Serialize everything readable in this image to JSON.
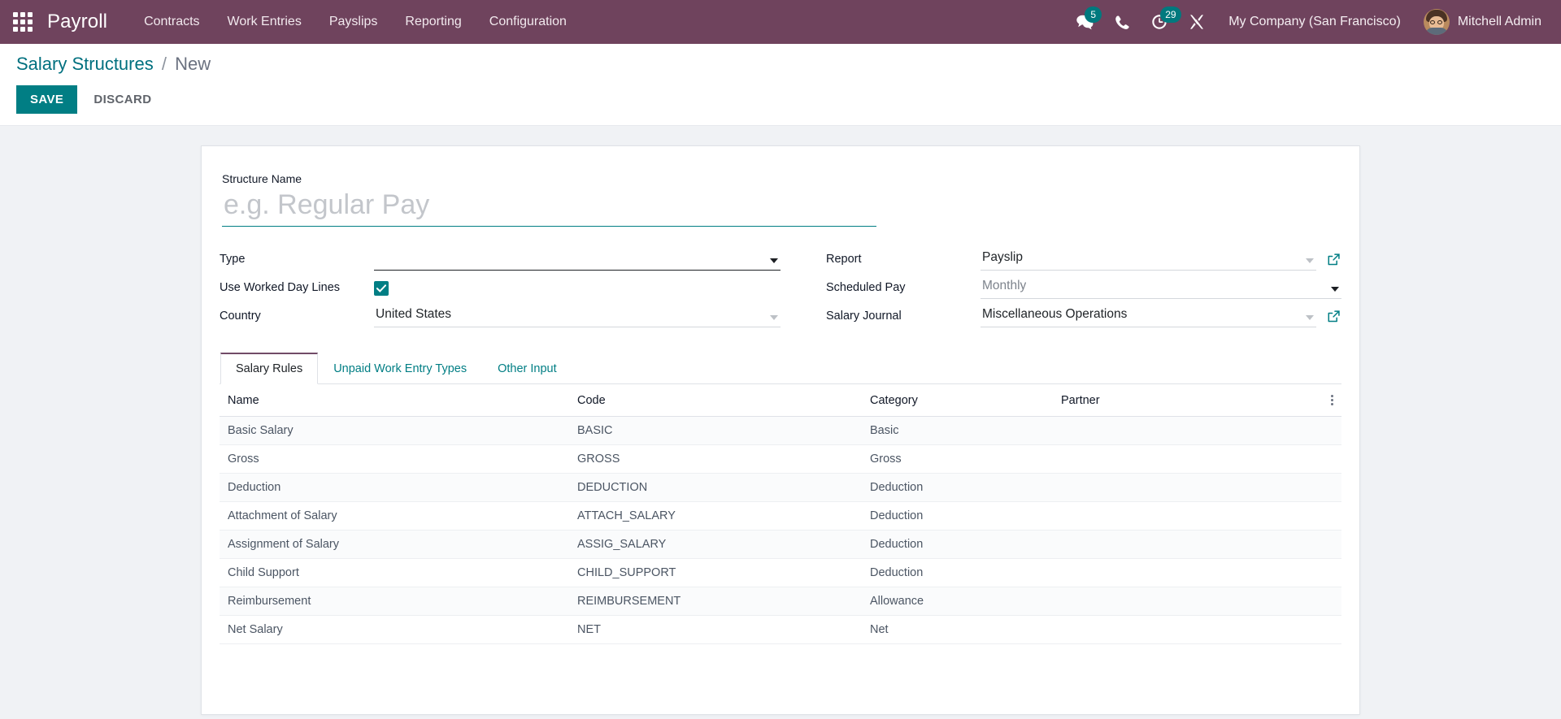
{
  "navbar": {
    "apps_icon": "apps-grid-icon",
    "brand": "Payroll",
    "menu": [
      {
        "label": "Contracts"
      },
      {
        "label": "Work Entries"
      },
      {
        "label": "Payslips"
      },
      {
        "label": "Reporting"
      },
      {
        "label": "Configuration"
      }
    ],
    "messages_icon": "messages-icon",
    "messages_count": "5",
    "phone_icon": "phone-icon",
    "activities_icon": "activities-clock-icon",
    "activities_count": "29",
    "debug_icon": "debug-tools-icon",
    "company": "My Company (San Francisco)",
    "avatar_icon": "user-avatar",
    "user": "Mitchell Admin",
    "bg_color": "#6f435d",
    "badge_color": "#00797e"
  },
  "control_panel": {
    "breadcrumb_root": "Salary Structures",
    "breadcrumb_separator": "/",
    "breadcrumb_current": "New",
    "save_label": "SAVE",
    "discard_label": "DISCARD",
    "save_color": "#017e84"
  },
  "form": {
    "title": {
      "label": "Structure Name",
      "value": "",
      "placeholder": "e.g. Regular Pay"
    },
    "left_fields": [
      {
        "label": "Type",
        "value": "",
        "widget": "dropdown",
        "caret": "dark",
        "underline": "dark",
        "external_link": false
      },
      {
        "label": "Use Worked Day Lines",
        "value": "",
        "widget": "checkbox",
        "checked": true,
        "external_link": false
      },
      {
        "label": "Country",
        "value": "United States",
        "widget": "many2one",
        "caret": "light",
        "underline": "light",
        "external_link": false
      }
    ],
    "right_fields": [
      {
        "label": "Report",
        "value": "Payslip",
        "widget": "many2one",
        "caret": "light",
        "underline": "light",
        "external_link": true
      },
      {
        "label": "Scheduled Pay",
        "value": "Monthly",
        "widget": "dropdown",
        "caret": "dark",
        "underline": "light",
        "muted": true,
        "external_link": false
      },
      {
        "label": "Salary Journal",
        "value": "Miscellaneous Operations",
        "widget": "many2one",
        "caret": "light",
        "underline": "light",
        "external_link": true
      }
    ]
  },
  "notebook": {
    "tabs": [
      {
        "label": "Salary Rules",
        "active": true
      },
      {
        "label": "Unpaid Work Entry Types",
        "active": false
      },
      {
        "label": "Other Input",
        "active": false
      }
    ]
  },
  "table": {
    "columns": [
      "Name",
      "Code",
      "Category",
      "Partner"
    ],
    "optional_columns_icon": "vertical-dots-icon",
    "rows": [
      {
        "name": "Basic Salary",
        "code": "BASIC",
        "category": "Basic",
        "partner": ""
      },
      {
        "name": "Gross",
        "code": "GROSS",
        "category": "Gross",
        "partner": ""
      },
      {
        "name": "Deduction",
        "code": "DEDUCTION",
        "category": "Deduction",
        "partner": ""
      },
      {
        "name": "Attachment of Salary",
        "code": "ATTACH_SALARY",
        "category": "Deduction",
        "partner": ""
      },
      {
        "name": "Assignment of Salary",
        "code": "ASSIG_SALARY",
        "category": "Deduction",
        "partner": ""
      },
      {
        "name": "Child Support",
        "code": "CHILD_SUPPORT",
        "category": "Deduction",
        "partner": ""
      },
      {
        "name": "Reimbursement",
        "code": "REIMBURSEMENT",
        "category": "Allowance",
        "partner": ""
      },
      {
        "name": "Net Salary",
        "code": "NET",
        "category": "Net",
        "partner": ""
      }
    ]
  }
}
